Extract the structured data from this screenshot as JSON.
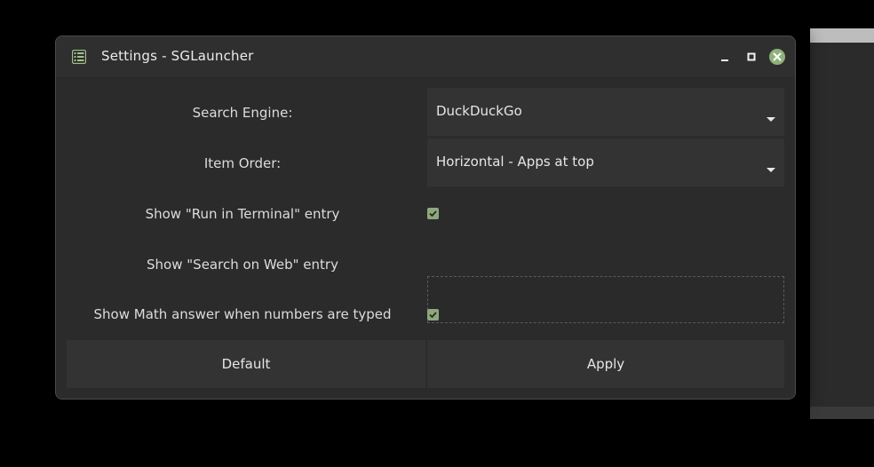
{
  "window": {
    "title": "Settings - SGLauncher",
    "app_icon": "settings-list-icon",
    "controls": [
      "minimize-icon",
      "maximize-icon",
      "close-icon"
    ],
    "accent_color": "#8fb27a"
  },
  "settings": {
    "search_engine": {
      "label": "Search Engine:",
      "value": "DuckDuckGo"
    },
    "item_order": {
      "label": "Item Order:",
      "value": "Horizontal - Apps at top"
    },
    "run_in_terminal": {
      "label": "Show \"Run in Terminal\" entry",
      "checked": true
    },
    "search_on_web": {
      "label": "Show \"Search on Web\" entry",
      "value": ""
    },
    "math_answer": {
      "label": "Show Math answer when numbers are typed",
      "checked": true
    }
  },
  "buttons": {
    "default_label": "Default",
    "apply_label": "Apply"
  }
}
